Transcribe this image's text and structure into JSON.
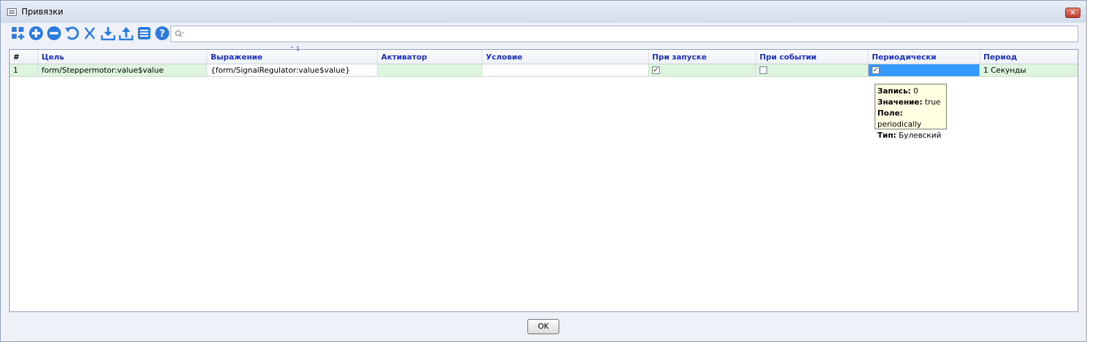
{
  "window": {
    "title": "Привязки",
    "close_label": "✕"
  },
  "toolbar": {
    "icons": [
      "add-grid-icon",
      "plus-circle-icon",
      "minus-circle-icon",
      "undo-icon",
      "bracket-expand-icon",
      "bracket-collapse-icon",
      "download-icon",
      "upload-icon",
      "list-icon",
      "help-icon"
    ]
  },
  "search": {
    "placeholder": "",
    "value": ""
  },
  "grid": {
    "sort_indicator": "1",
    "columns": [
      "#",
      "Цель",
      "Выражение",
      "Активатор",
      "Условие",
      "При запуске",
      "При событии",
      "Периодически",
      "Период"
    ],
    "rows": [
      {
        "num": "1",
        "target": "form/Steppermotor:value$value",
        "expression": "{form/SignalRegulator:value$value}",
        "activator": "",
        "condition": "",
        "on_start": "✓",
        "on_event": "",
        "periodic": "✓",
        "period": "1 Секунды"
      }
    ]
  },
  "tooltip": {
    "k1": "Запись:",
    "v1": "0",
    "k2": "Значение:",
    "v2": "true",
    "k3": "Поле:",
    "v3": "periodically",
    "k4": "Тип:",
    "v4": "Булевский"
  },
  "footer": {
    "ok_label": "OK"
  },
  "colors": {
    "header_text": "#1b2fc9",
    "row_bg": "#ddf5dc",
    "selection": "#3399ff",
    "toolbar_icon": "#2b7be0"
  }
}
